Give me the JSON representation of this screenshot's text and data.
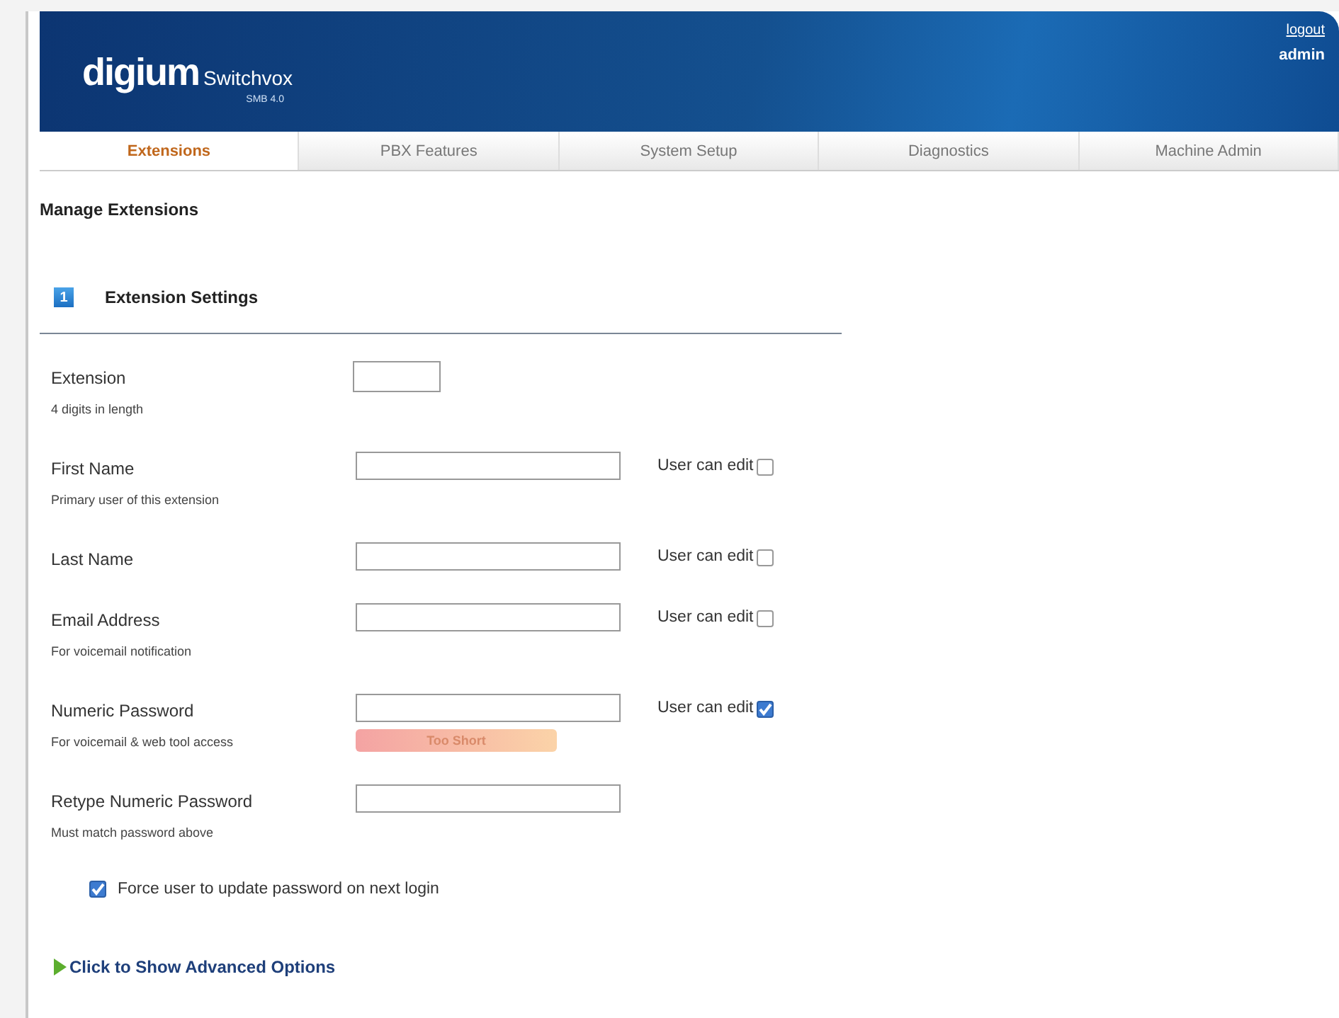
{
  "header": {
    "logo": {
      "brand": "digium",
      "product": "Switchvox",
      "edition": "SMB 4.0"
    },
    "logout_link": "logout",
    "user": "admin"
  },
  "tabs": [
    {
      "label": "Extensions",
      "selected": true
    },
    {
      "label": "PBX Features",
      "selected": false
    },
    {
      "label": "System Setup",
      "selected": false
    },
    {
      "label": "Diagnostics",
      "selected": false
    },
    {
      "label": "Machine Admin",
      "selected": false
    }
  ],
  "page_title": "Manage Extensions",
  "section": {
    "number": "1",
    "title": "Extension Settings"
  },
  "fields": [
    {
      "label": "Extension",
      "hint": "4 digits in length",
      "kind": "short"
    },
    {
      "kind": "wide",
      "label": "First Name",
      "hint": "Primary user of this extension",
      "user_edit": {
        "label": "User can edit",
        "checked": false
      }
    },
    {
      "kind": "wide",
      "label": "Last Name",
      "user_edit": {
        "label": "User can edit",
        "checked": false
      }
    },
    {
      "kind": "wide",
      "label": "Email Address",
      "hint": "For voicemail notification",
      "user_edit": {
        "label": "User can edit",
        "checked": false
      }
    },
    {
      "kind": "wide",
      "label": "Numeric Password",
      "hint": "For voicemail & web tool access",
      "user_edit": {
        "label": "User can edit",
        "checked": true
      },
      "strength": "Too Short"
    },
    {
      "kind": "wide",
      "label": "Retype Numeric Password",
      "hint": "Must match password above"
    }
  ],
  "force_update": {
    "label": "Force user to update password on next login",
    "checked": true
  },
  "advanced_link": "Click to Show Advanced Options"
}
